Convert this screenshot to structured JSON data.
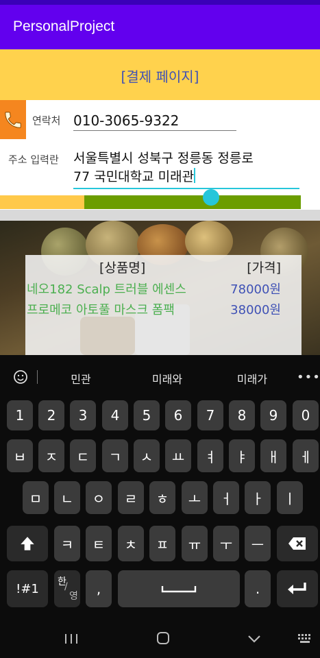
{
  "app": {
    "title": "PersonalProject"
  },
  "header": {
    "title": "[결제 페이지]"
  },
  "form": {
    "contact_label": "연락처",
    "contact_value": "010-3065-9322",
    "address_label": "주소 입력란",
    "address_line1": "서울특별시 성북구 정릉동 정릉로",
    "address_line2": "77 국민대학교 미래관"
  },
  "progress": {
    "fraction": 0.72
  },
  "products": {
    "name_header": "[상품명]",
    "price_header": "[가격]",
    "rows": [
      {
        "name": "네오182 Scalp 트러블 에센스",
        "price": "78000원"
      },
      {
        "name": "프로메코 아토풀 마스크 폼팩",
        "price": "38000원"
      }
    ]
  },
  "keyboard": {
    "suggestions": [
      "민관",
      "미래와",
      "미래가"
    ],
    "row1": [
      "1",
      "2",
      "3",
      "4",
      "5",
      "6",
      "7",
      "8",
      "9",
      "0"
    ],
    "row2": [
      "ㅂ",
      "ㅈ",
      "ㄷ",
      "ㄱ",
      "ㅅ",
      "ㅛ",
      "ㅕ",
      "ㅑ",
      "ㅐ",
      "ㅔ"
    ],
    "row3": [
      "ㅁ",
      "ㄴ",
      "ㅇ",
      "ㄹ",
      "ㅎ",
      "ㅗ",
      "ㅓ",
      "ㅏ",
      "ㅣ"
    ],
    "row4": [
      "ㅋ",
      "ㅌ",
      "ㅊ",
      "ㅍ",
      "ㅠ",
      "ㅜ",
      "ㅡ"
    ],
    "symbols_key": "!#1",
    "lang_key_top": "한",
    "lang_key_bottom": "영",
    "comma_key": ",",
    "period_key": "."
  },
  "icons": {
    "phone": "phone-icon",
    "shift": "shift-icon",
    "backspace": "backspace-icon",
    "enter": "enter-icon",
    "space": "space-icon",
    "emoji": "emoji-icon",
    "more": "more-icon",
    "recents": "recents-icon",
    "home": "home-icon",
    "back": "back-chevron-icon",
    "keyboard_hide": "keyboard-icon"
  },
  "colors": {
    "app_bar": "#6200ee",
    "header_band": "#ffd24d",
    "accent": "#26c6da",
    "progress_fill": "#6b9d00",
    "product_name": "#4caf50",
    "product_price": "#3f51b5"
  }
}
